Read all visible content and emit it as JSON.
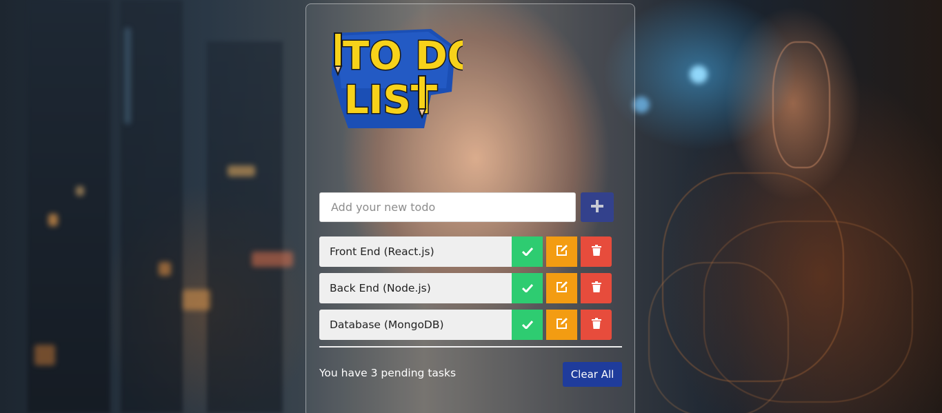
{
  "app": {
    "logo_text_line1": "TO DO",
    "logo_text_line2": "LIST"
  },
  "input": {
    "placeholder": "Add your new todo",
    "value": "",
    "add_icon": "plus-icon"
  },
  "todos": [
    {
      "text": "Front End (React.js)"
    },
    {
      "text": "Back End (Node.js)"
    },
    {
      "text": "Database (MongoDB)"
    }
  ],
  "actions": {
    "complete_icon": "check-icon",
    "edit_icon": "edit-icon",
    "delete_icon": "trash-icon"
  },
  "footer": {
    "pending_text": "You have 3 pending tasks",
    "clear_label": "Clear All"
  },
  "colors": {
    "add_button": "#33418c",
    "complete": "#2ecc71",
    "edit": "#f39c12",
    "delete": "#e74c3c",
    "clear_button": "#1f3c9c"
  }
}
